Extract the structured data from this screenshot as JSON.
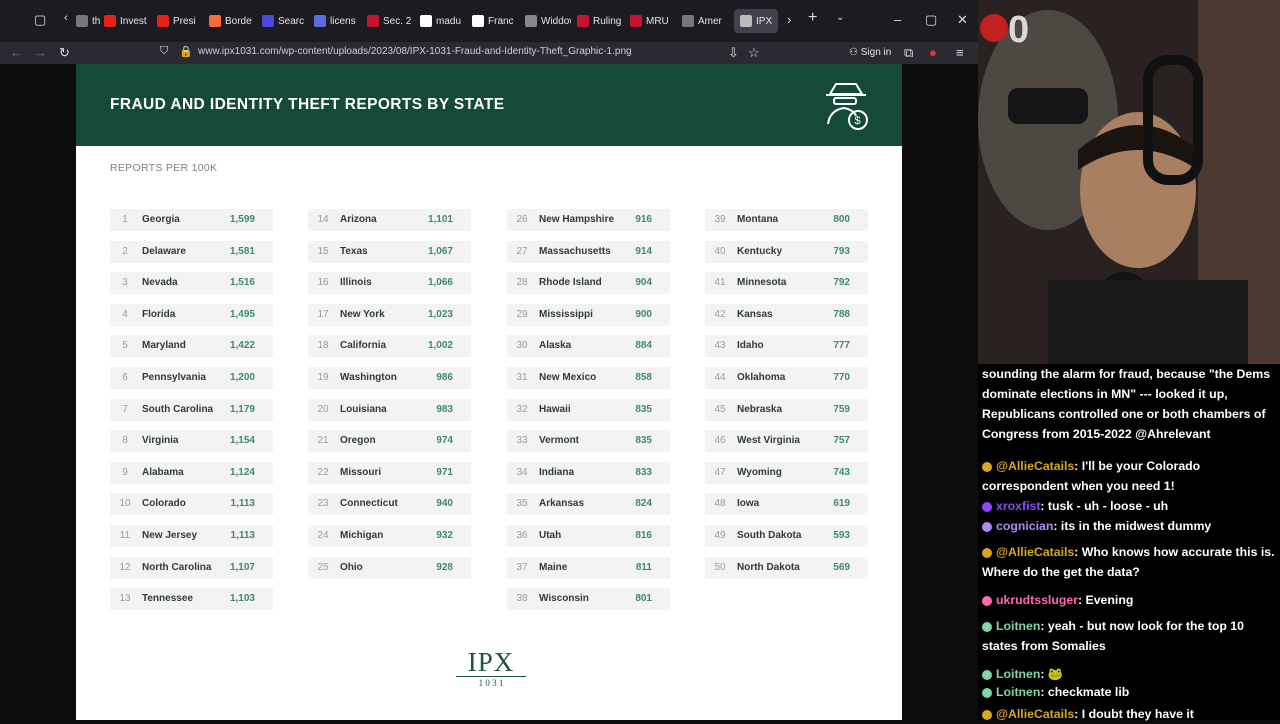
{
  "browser": {
    "tabs": [
      {
        "label": "th",
        "color": "#777777"
      },
      {
        "label": "Invest",
        "color": "#e62117"
      },
      {
        "label": "Presi",
        "color": "#e62117"
      },
      {
        "label": "Borde",
        "color": "#ff6a3d"
      },
      {
        "label": "Searc",
        "color": "#4a4ae0"
      },
      {
        "label": "licens",
        "color": "#5b6be0"
      },
      {
        "label": "Sec. 2",
        "color": "#c3162e"
      },
      {
        "label": "madu",
        "color": "#ffffff"
      },
      {
        "label": "Franc",
        "color": "#ffffff"
      },
      {
        "label": "Widdows",
        "color": "#888888"
      },
      {
        "label": "Ruling",
        "color": "#c3162e"
      },
      {
        "label": "MRU",
        "color": "#c3162e"
      },
      {
        "label": "Amer",
        "color": "#777777"
      },
      {
        "label": "IPX",
        "color": "#bbbbbb"
      }
    ],
    "url": "www.ipx1031.com/wp-content/uploads/2023/08/IPX-1031-Fraud-and-Identity-Theft_Graphic-1.png",
    "sign_in": "Sign in"
  },
  "infographic": {
    "title": "FRAUD AND IDENTITY THEFT REPORTS BY STATE",
    "subtitle": "REPORTS PER 100K",
    "logo_main": "IPX",
    "logo_sub": "1 0 3 1",
    "brand_color": "#154a3a",
    "value_color": "#3d8a6b",
    "rankings": [
      {
        "rank": "1",
        "state": "Georgia",
        "value": "1,599"
      },
      {
        "rank": "2",
        "state": "Delaware",
        "value": "1,581"
      },
      {
        "rank": "3",
        "state": "Nevada",
        "value": "1,516"
      },
      {
        "rank": "4",
        "state": "Florida",
        "value": "1,495"
      },
      {
        "rank": "5",
        "state": "Maryland",
        "value": "1,422"
      },
      {
        "rank": "6",
        "state": "Pennsylvania",
        "value": "1,200"
      },
      {
        "rank": "7",
        "state": "South Carolina",
        "value": "1,179"
      },
      {
        "rank": "8",
        "state": "Virginia",
        "value": "1,154"
      },
      {
        "rank": "9",
        "state": "Alabama",
        "value": "1,124"
      },
      {
        "rank": "10",
        "state": "Colorado",
        "value": "1,113"
      },
      {
        "rank": "11",
        "state": "New Jersey",
        "value": "1,113"
      },
      {
        "rank": "12",
        "state": "North Carolina",
        "value": "1,107"
      },
      {
        "rank": "13",
        "state": "Tennessee",
        "value": "1,103"
      },
      {
        "rank": "14",
        "state": "Arizona",
        "value": "1,101"
      },
      {
        "rank": "15",
        "state": "Texas",
        "value": "1,067"
      },
      {
        "rank": "16",
        "state": "Illinois",
        "value": "1,066"
      },
      {
        "rank": "17",
        "state": "New York",
        "value": "1,023"
      },
      {
        "rank": "18",
        "state": "California",
        "value": "1,002"
      },
      {
        "rank": "19",
        "state": "Washington",
        "value": "986"
      },
      {
        "rank": "20",
        "state": "Louisiana",
        "value": "983"
      },
      {
        "rank": "21",
        "state": "Oregon",
        "value": "974"
      },
      {
        "rank": "22",
        "state": "Missouri",
        "value": "971"
      },
      {
        "rank": "23",
        "state": "Connecticut",
        "value": "940"
      },
      {
        "rank": "24",
        "state": "Michigan",
        "value": "932"
      },
      {
        "rank": "25",
        "state": "Ohio",
        "value": "928"
      },
      {
        "rank": "26",
        "state": "New Hampshire",
        "value": "916"
      },
      {
        "rank": "27",
        "state": "Massachusetts",
        "value": "914"
      },
      {
        "rank": "28",
        "state": "Rhode Island",
        "value": "904"
      },
      {
        "rank": "29",
        "state": "Mississippi",
        "value": "900"
      },
      {
        "rank": "30",
        "state": "Alaska",
        "value": "884"
      },
      {
        "rank": "31",
        "state": "New Mexico",
        "value": "858"
      },
      {
        "rank": "32",
        "state": "Hawaii",
        "value": "835"
      },
      {
        "rank": "33",
        "state": "Vermont",
        "value": "835"
      },
      {
        "rank": "34",
        "state": "Indiana",
        "value": "833"
      },
      {
        "rank": "35",
        "state": "Arkansas",
        "value": "824"
      },
      {
        "rank": "36",
        "state": "Utah",
        "value": "816"
      },
      {
        "rank": "37",
        "state": "Maine",
        "value": "811"
      },
      {
        "rank": "38",
        "state": "Wisconsin",
        "value": "801"
      },
      {
        "rank": "39",
        "state": "Montana",
        "value": "800"
      },
      {
        "rank": "40",
        "state": "Kentucky",
        "value": "793"
      },
      {
        "rank": "41",
        "state": "Minnesota",
        "value": "792"
      },
      {
        "rank": "42",
        "state": "Kansas",
        "value": "788"
      },
      {
        "rank": "43",
        "state": "Idaho",
        "value": "777"
      },
      {
        "rank": "44",
        "state": "Oklahoma",
        "value": "770"
      },
      {
        "rank": "45",
        "state": "Nebraska",
        "value": "759"
      },
      {
        "rank": "46",
        "state": "West Virginia",
        "value": "757"
      },
      {
        "rank": "47",
        "state": "Wyoming",
        "value": "743"
      },
      {
        "rank": "48",
        "state": "Iowa",
        "value": "619"
      },
      {
        "rank": "49",
        "state": "South Dakota",
        "value": "593"
      },
      {
        "rank": "50",
        "state": "North Dakota",
        "value": "569"
      }
    ]
  },
  "stream": {
    "overlay_count": "0",
    "chat": [
      {
        "user": "",
        "color": "#ffffff",
        "text": "sounding the alarm for fraud, because \"the Dems dominate elections in MN\" --- looked it up, Republicans controlled one or both chambers of Congress from 2015-2022 @Ahrelevant"
      },
      {
        "user": "@AllieCatails",
        "color": "#daa520",
        "text": ": I'll be your Colorado correspondent when you need 1!"
      },
      {
        "user": "xroxfist",
        "color": "#9146ff",
        "text": ": tusk - uh - loose - uh"
      },
      {
        "user": "cognician",
        "color": "#b288f5",
        "text": ": its in the midwest dummy"
      },
      {
        "user": "@AllieCatails",
        "color": "#daa520",
        "text": ": Who knows how accurate this is. Where do the get the data?"
      },
      {
        "user": "ukrudtssluger",
        "color": "#ff69b4",
        "text": ": Evening"
      },
      {
        "user": "Loitnen",
        "color": "#7fd4a8",
        "text": ": yeah - but now look for the top 10 states from Somalies"
      },
      {
        "user": "Loitnen",
        "color": "#7fd4a8",
        "text": ": 🐸"
      },
      {
        "user": "Loitnen",
        "color": "#7fd4a8",
        "text": ": checkmate lib"
      },
      {
        "user": "@AllieCatails",
        "color": "#daa520",
        "text": ": I doubt they have it"
      }
    ]
  }
}
